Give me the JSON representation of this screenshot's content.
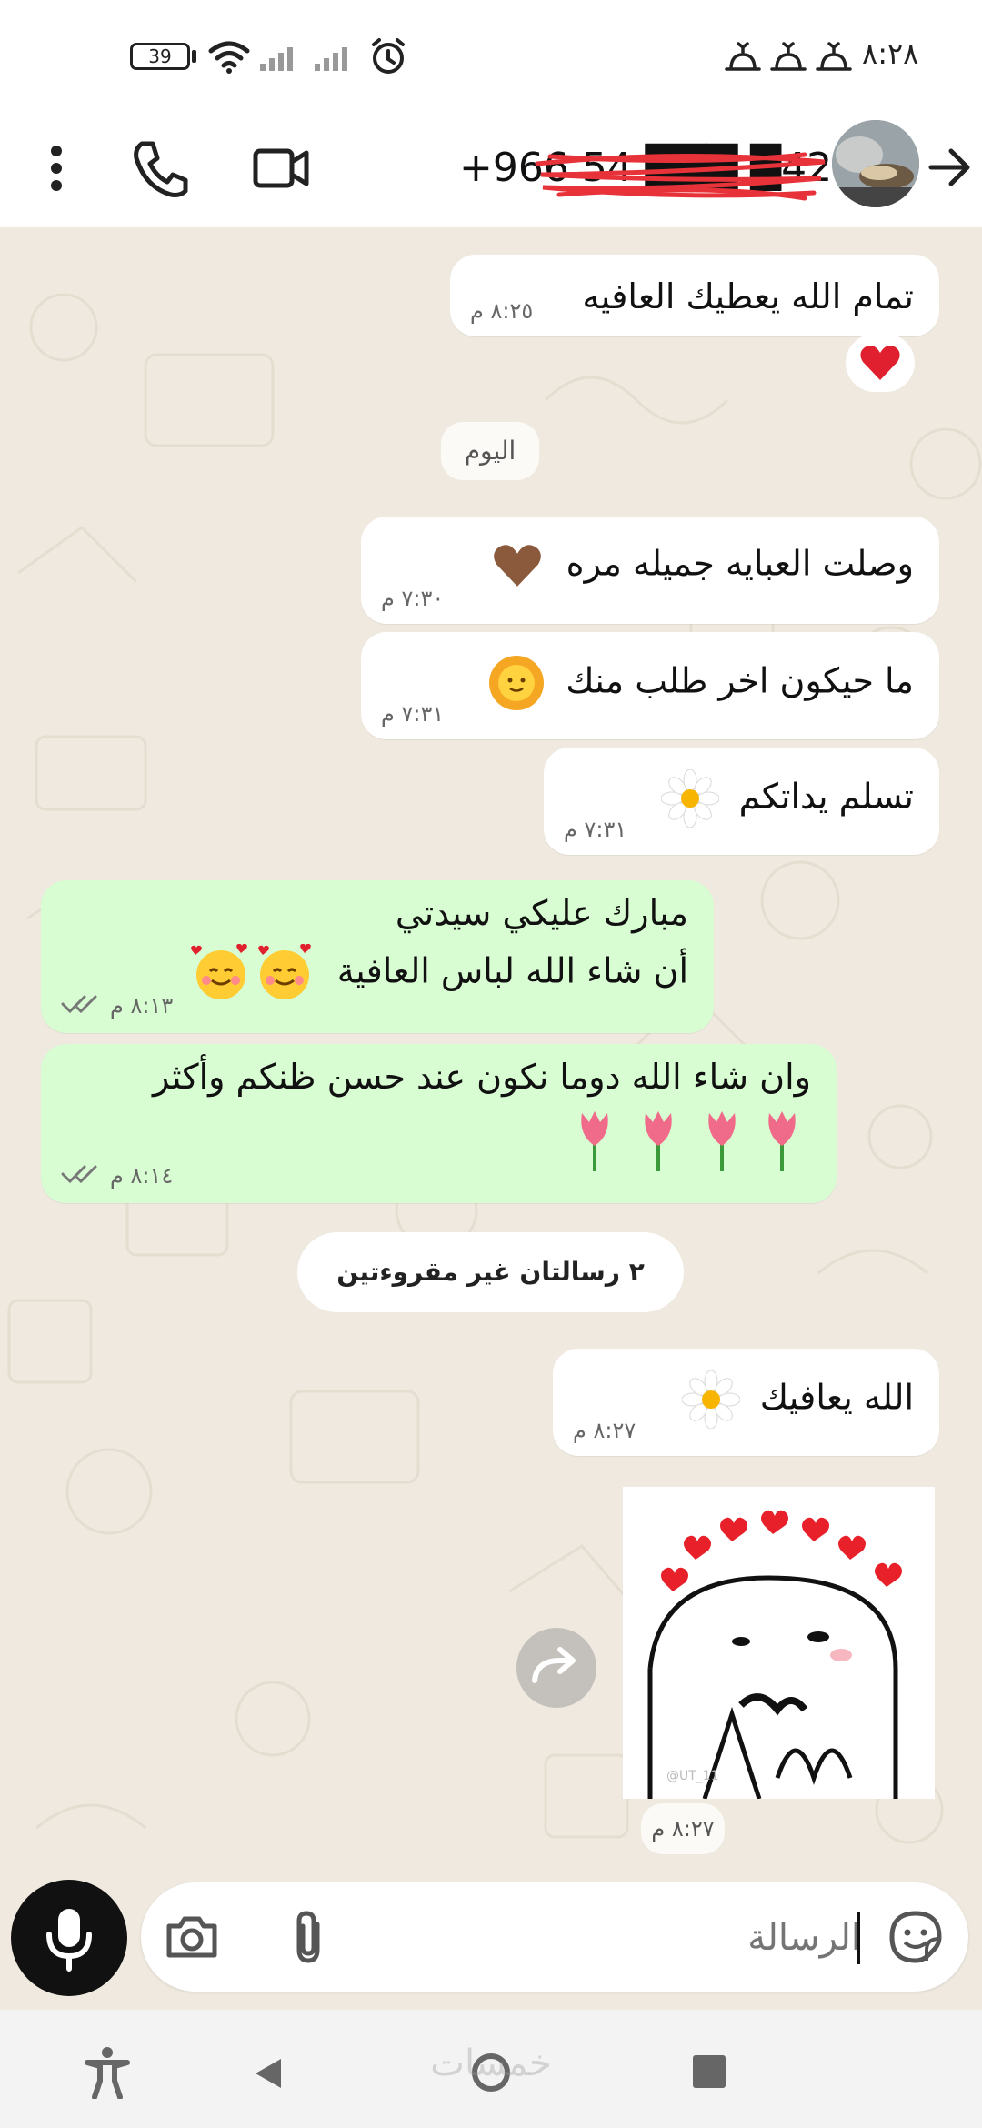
{
  "status_bar": {
    "time": "٨:٢٨",
    "battery": "39",
    "icons": [
      "battery-icon",
      "wifi-icon",
      "signal-icon",
      "alarm-icon",
      "notification-icon"
    ]
  },
  "header": {
    "contact_number": "+966 54 ███ █420",
    "icons": [
      "back-arrow-icon",
      "video-call-icon",
      "phone-icon",
      "more-icon"
    ]
  },
  "messages": [
    {
      "text": "تمام الله يعطيك العافيه",
      "time": "٨:٢٥ م",
      "direction": "in"
    },
    {
      "text": "وصلت العبايه جميله مره",
      "time": "٧:٣٠ م",
      "direction": "in",
      "emoji": "brown-heart"
    },
    {
      "text": "ما حيكون اخر طلب منك",
      "time": "٧:٣١ م",
      "direction": "in",
      "emoji": "sun-face"
    },
    {
      "text": "تسلم يداتكم",
      "time": "٧:٣١ م",
      "direction": "in",
      "emoji": "daisy"
    },
    {
      "line1": "مبارك عليكي سيدتي",
      "line2": "أن شاء الله لباس العافية",
      "time": "٨:١٣ م",
      "direction": "out",
      "emoji": "smiling-hearts"
    },
    {
      "line1": "وان شاء الله دوما  نكون عند حسن ظنكم وأكثر",
      "time": "٨:١٤ م",
      "direction": "out",
      "emoji": "tulip"
    },
    {
      "text": "الله يعافيك",
      "time": "٨:٢٧ م",
      "direction": "in",
      "emoji": "daisy"
    },
    {
      "sticker_caption": "@UT_11",
      "time": "٨:٢٧ م",
      "direction": "in"
    }
  ],
  "labels": {
    "today": "اليوم",
    "unread": "٢ رسالتان غير مقروءتين"
  },
  "input": {
    "placeholder": "الرسالة"
  },
  "nav": {
    "watermark": "خمسات"
  },
  "colors": {
    "outgoing_bubble": "#d8fdd2",
    "incoming_bubble": "#ffffff",
    "background": "#efe9df",
    "read_ticks": "#53bdeb",
    "reaction_heart": "#e0202e"
  }
}
